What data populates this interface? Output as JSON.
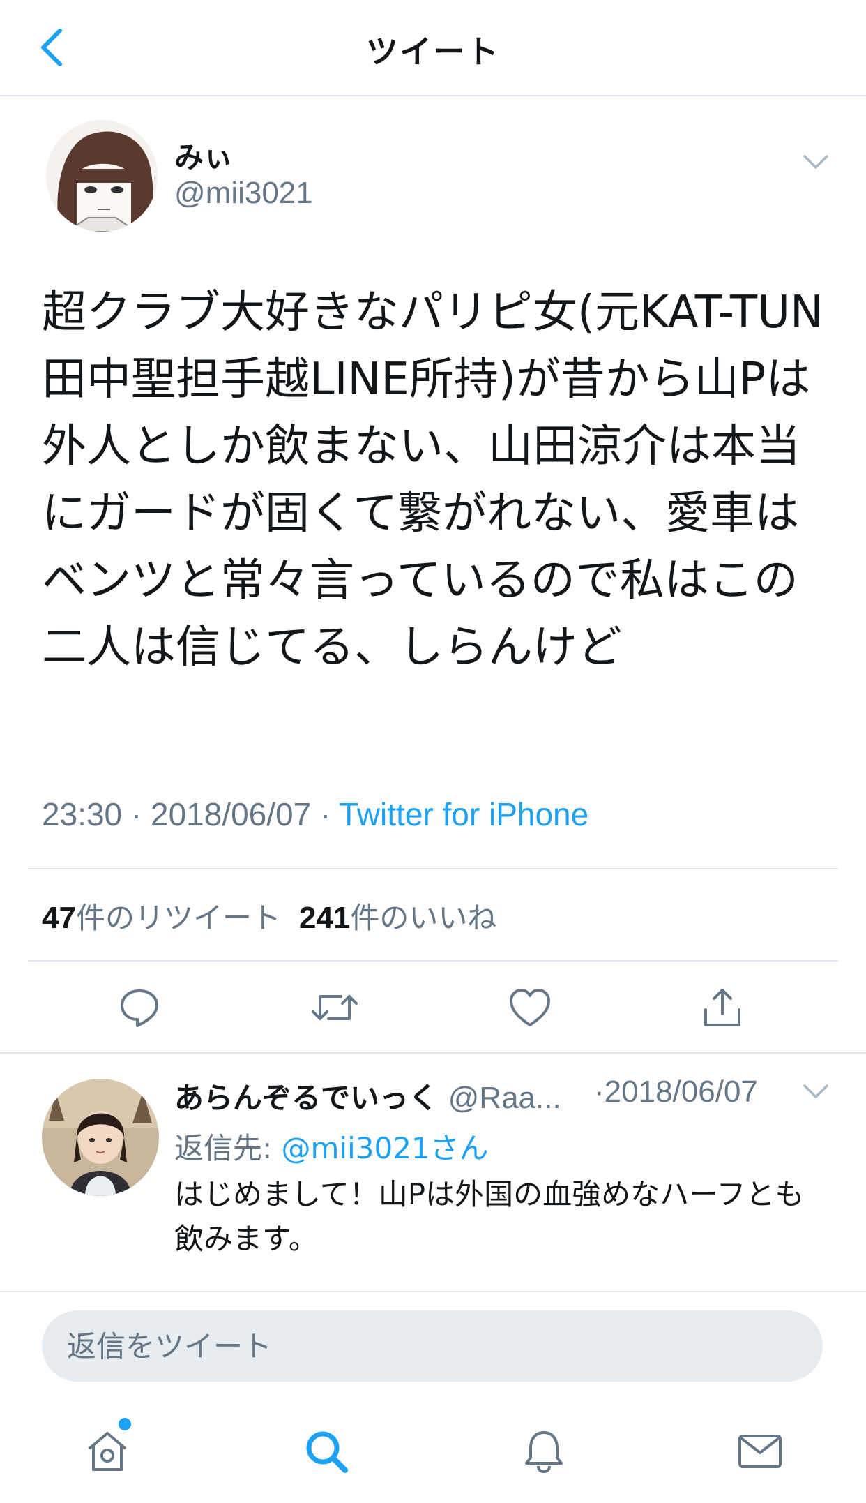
{
  "header": {
    "title": "ツイート"
  },
  "tweet": {
    "name": "みぃ",
    "handle": "@mii3021",
    "text": "超クラブ大好きなパリピ女(元KAT-TUN田中聖担手越LINE所持)が昔から山Pは外人としか飲まない、山田涼介は本当にガードが固くて繋がれない、愛車はベンツと常々言っているので私はこの二人は信じてる、しらんけど",
    "time": "23:30 · 2018/06/07 · ",
    "source": "Twitter for iPhone",
    "retweets_count": "47",
    "retweets_label": "件のリツイート",
    "likes_count": "241",
    "likes_label": "件のいいね"
  },
  "reply": {
    "name": "あらんぞるでいっく",
    "handle": "@Raa...",
    "date": "·2018/06/07",
    "reply_to_label": "返信先: ",
    "reply_to_mention": "@mii3021さん",
    "text": "はじめまして！山Pは外国の血強めなハーフとも飲みます。"
  },
  "composer": {
    "placeholder": "返信をツイート"
  },
  "colors": {
    "accent": "#1da1f2",
    "muted": "#657786",
    "divider": "#e1e8ed",
    "text": "#14171a"
  },
  "icons": {
    "header": "chevron-left-icon",
    "actions": [
      "reply-icon",
      "retweet-icon",
      "like-icon",
      "share-icon"
    ],
    "tabs": [
      "home-icon",
      "search-icon",
      "notifications-icon",
      "messages-icon"
    ]
  }
}
